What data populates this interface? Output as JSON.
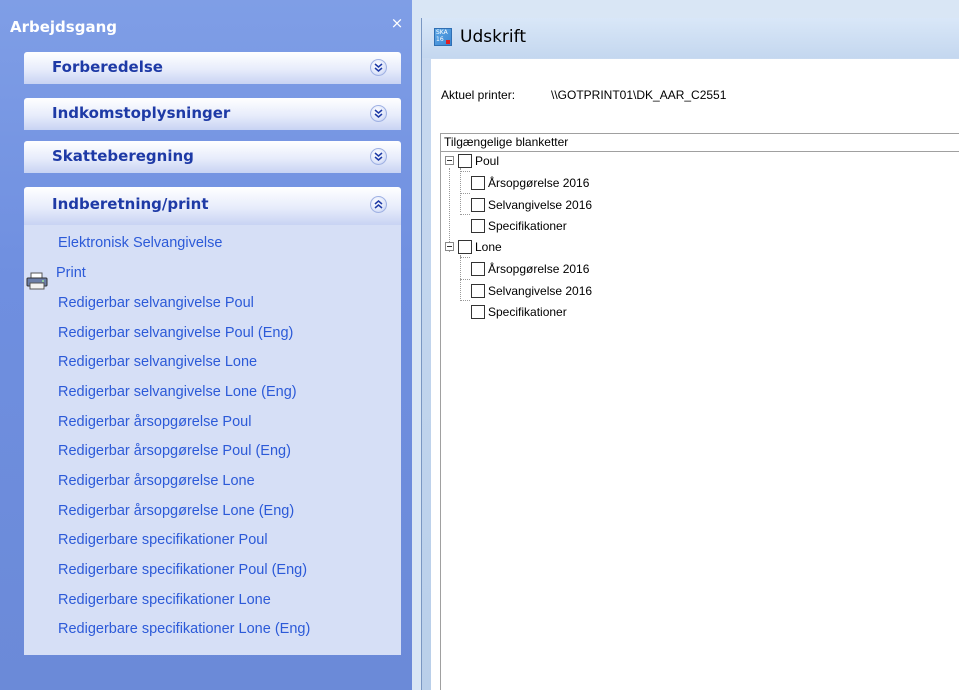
{
  "task_pane": {
    "title": "Arbejdsgang",
    "close_glyph": "×",
    "groups": [
      {
        "label": "Forberedelse",
        "state": "collapsed"
      },
      {
        "label": "Indkomstoplysninger",
        "state": "collapsed"
      },
      {
        "label": "Skatteberegning",
        "state": "collapsed"
      },
      {
        "label": "Indberetning/print",
        "state": "expanded"
      }
    ],
    "tasks": [
      "Elektronisk Selvangivelse",
      "Print",
      "Redigerbar selvangivelse Poul",
      "Redigerbar selvangivelse Poul (Eng)",
      "Redigerbar selvangivelse Lone",
      "Redigerbar selvangivelse Lone (Eng)",
      "Redigerbar årsopgørelse Poul",
      "Redigerbar årsopgørelse Poul (Eng)",
      "Redigerbar årsopgørelse Lone",
      "Redigerbar årsopgørelse Lone (Eng)",
      "Redigerbare specifikationer Poul",
      "Redigerbare specifikationer Poul (Eng)",
      "Redigerbare specifikationer Lone",
      "Redigerbare specifikationer Lone (Eng)"
    ],
    "icons": {
      "chevron_collapsed": "double-chevron-down-icon",
      "chevron_expanded": "double-chevron-up-icon",
      "print": "printer-icon"
    }
  },
  "dialog": {
    "title": "Udskrift",
    "app_icon_text": "SKA 16",
    "printer_label": "Aktuel printer:",
    "printer_value": "\\\\GOTPRINT01\\DK_AAR_C2551",
    "tree_header": "Tilgængelige blanketter",
    "tree": [
      {
        "label": "Poul",
        "checked": false,
        "children": [
          {
            "label": "Årsopgørelse 2016",
            "checked": false
          },
          {
            "label": "Selvangivelse 2016",
            "checked": false
          },
          {
            "label": "Specifikationer",
            "checked": false
          }
        ]
      },
      {
        "label": "Lone",
        "checked": false,
        "children": [
          {
            "label": "Årsopgørelse 2016",
            "checked": false
          },
          {
            "label": "Selvangivelse 2016",
            "checked": false
          },
          {
            "label": "Specifikationer",
            "checked": false
          }
        ]
      }
    ]
  },
  "colors": {
    "pane_bg": "#7f9ee6",
    "header_text": "#1e3aa6",
    "task_link": "#2c5ad8",
    "group_body": "#d6dff6"
  }
}
